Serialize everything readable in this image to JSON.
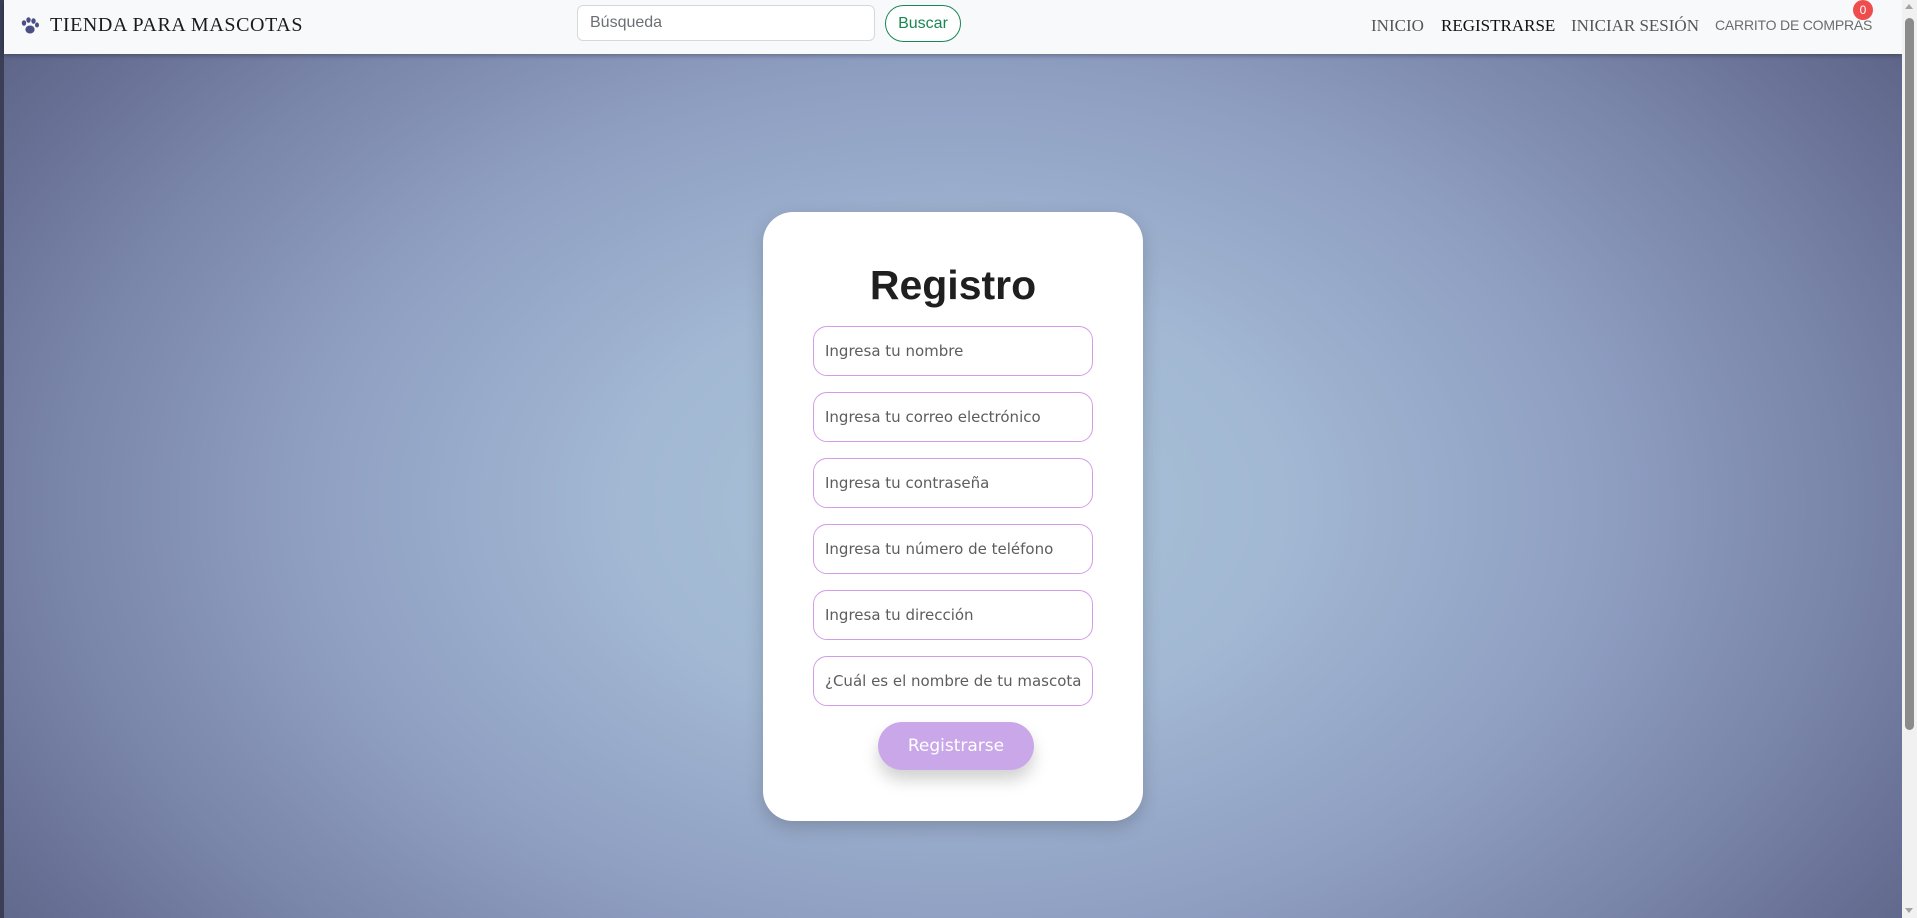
{
  "navbar": {
    "brand": {
      "icon": "paw-icon",
      "name": "TIENDA PARA MASCOTAS"
    },
    "search": {
      "placeholder": "Búsqueda",
      "button_label": "Buscar"
    },
    "links": {
      "inicio": "INICIO",
      "registrarse": "REGISTRARSE",
      "iniciar_sesion": "INICIAR SESIÓN",
      "carrito": "CARRITO DE COMPRAS"
    },
    "cart_count": "0"
  },
  "registration": {
    "title": "Registro",
    "fields": {
      "nombre": "Ingresa tu nombre",
      "correo": "Ingresa tu correo electrónico",
      "contrasena": "Ingresa tu contraseña",
      "telefono": "Ingresa tu número de teléfono",
      "direccion": "Ingresa tu dirección",
      "mascota": "¿Cuál es el nombre de tu mascota?"
    },
    "submit_label": "Registrarse"
  },
  "colors": {
    "accent_green": "#198754",
    "field_border": "#d49ce8",
    "submit_button": "#c9a7e8",
    "badge_red": "#ef4d4d",
    "navbar_bg": "#f8f9fa"
  }
}
